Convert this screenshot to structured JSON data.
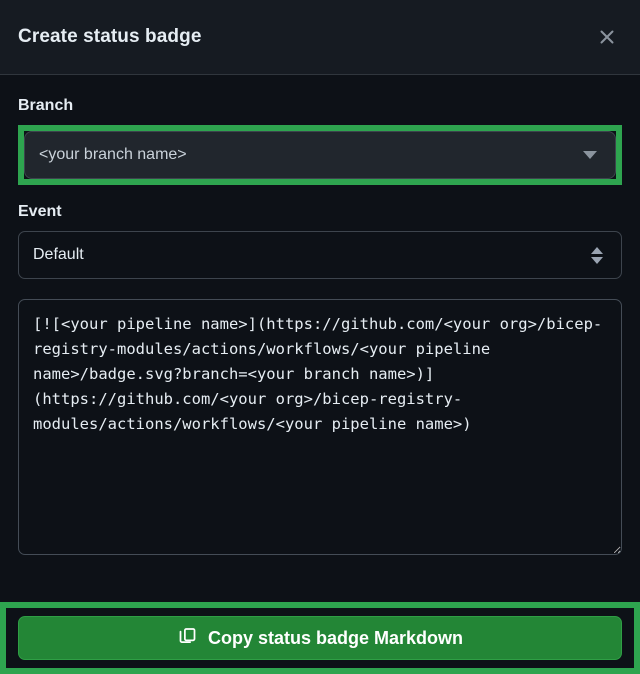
{
  "dialog": {
    "title": "Create status badge",
    "close_icon": "close-icon"
  },
  "branch": {
    "label": "Branch",
    "selected": "<your branch name>",
    "dropdown_icon": "chevron-down-icon",
    "highlight_color": "#2ea44f"
  },
  "event": {
    "label": "Event",
    "selected": "Default",
    "dropdown_icon": "up-down-arrows-icon"
  },
  "markdown": {
    "value": "[![<your pipeline name>](https://github.com/<your org>/bicep-registry-modules/actions/workflows/<your pipeline name>/badge.svg?branch=<your branch name>)](https://github.com/<your org>/bicep-registry-modules/actions/workflows/<your pipeline name>)",
    "placeholder": ""
  },
  "footer": {
    "copy_label": "Copy status badge Markdown",
    "copy_icon": "copy-icon",
    "button_color": "#238636",
    "highlight_color": "#2ea44f"
  }
}
